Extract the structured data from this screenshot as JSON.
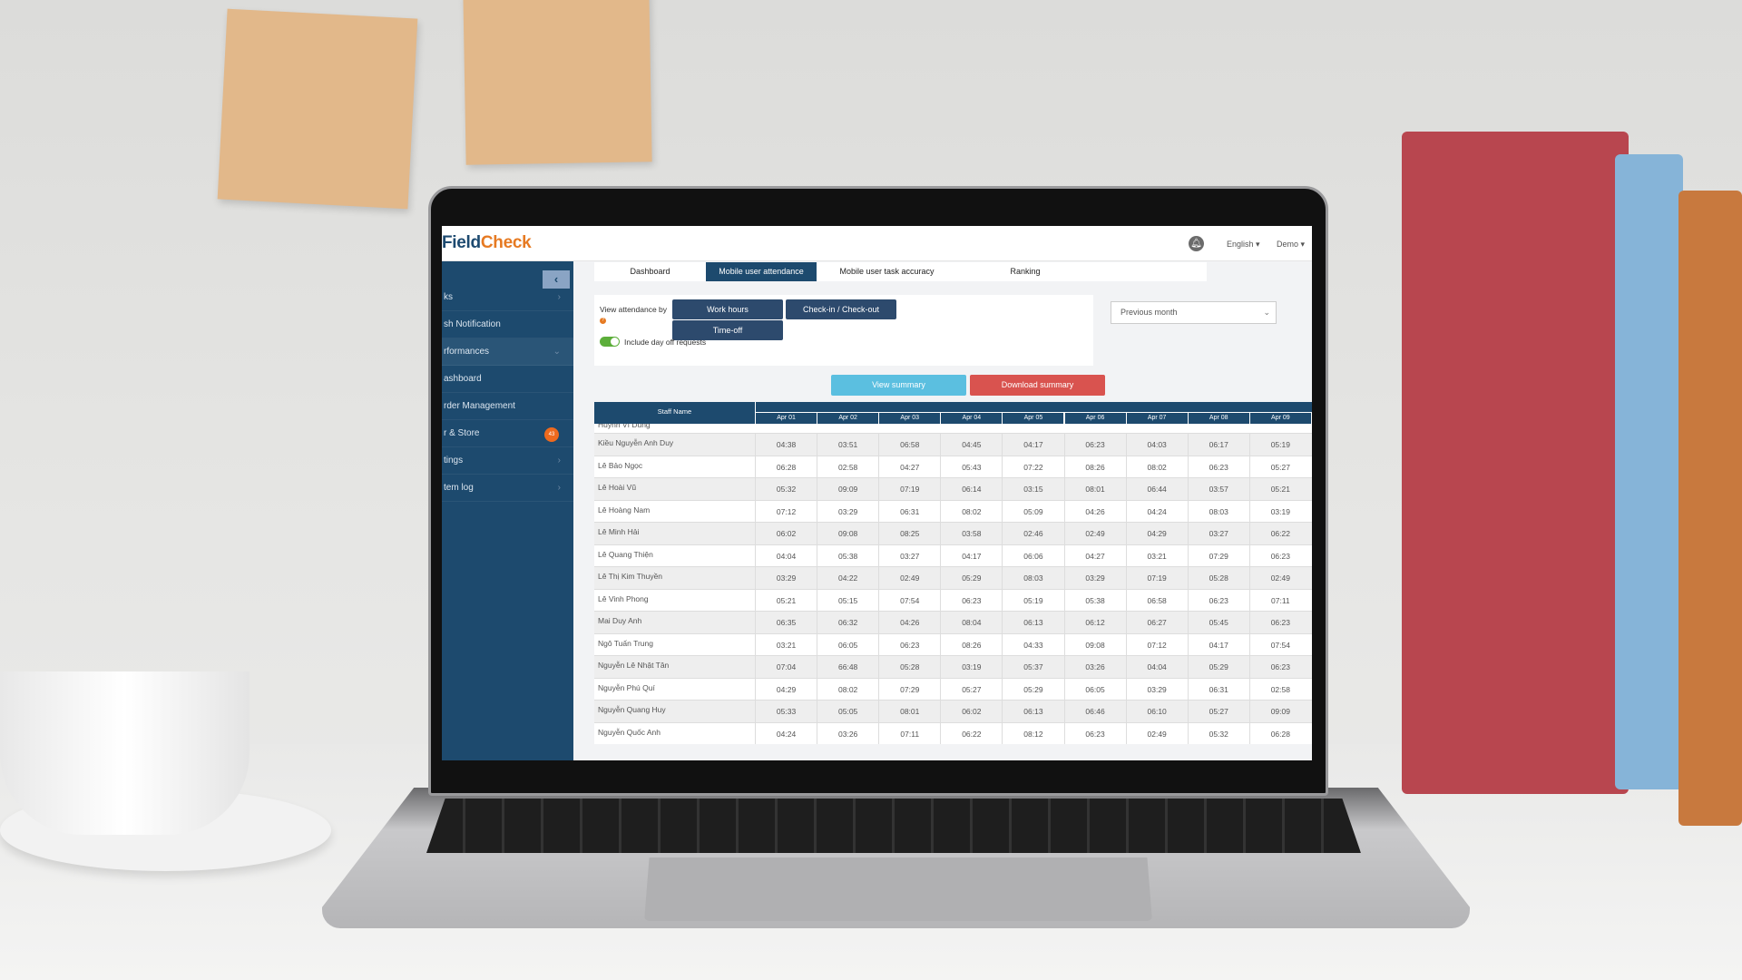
{
  "app": {
    "logo_a": "Field",
    "logo_b": "Check",
    "language": "English ▾",
    "user": "Demo ▾"
  },
  "sidebar": {
    "collapse_icon": "‹",
    "items": [
      {
        "label": "ks",
        "chevron": "›"
      },
      {
        "label": "sh Notification",
        "chevron": ""
      },
      {
        "label": "rformances",
        "chevron": "⌄"
      },
      {
        "label": "ashboard",
        "chevron": ""
      },
      {
        "label": "rder Management",
        "chevron": ""
      },
      {
        "label": "r & Store",
        "badge": "43"
      },
      {
        "label": "tings",
        "chevron": "›"
      },
      {
        "label": "tem log",
        "chevron": "›"
      }
    ]
  },
  "tabs": [
    {
      "label": "Dashboard"
    },
    {
      "label": "Mobile user attendance",
      "active": true
    },
    {
      "label": "Mobile user task accuracy"
    },
    {
      "label": "Ranking"
    }
  ],
  "filters": {
    "view_by_label": "View attendance by",
    "help_icon": "?",
    "work_hours": "Work hours",
    "check_in_out": "Check-in / Check-out",
    "time_off": "Time-off",
    "include_day_off": "Include day off requests",
    "include_day_off_on": true,
    "period": "Previous month"
  },
  "actions": {
    "view_summary": "View summary",
    "download_summary": "Download summary"
  },
  "colors": {
    "primary": "#1d4a6e",
    "accent": "#e67a22",
    "view": "#5bbfe0",
    "download": "#d9534f",
    "toggle": "#5cae3a"
  },
  "table": {
    "name_header": "Staff Name",
    "dates": [
      "Apr 01",
      "Apr 02",
      "Apr 03",
      "Apr 04",
      "Apr 05",
      "Apr 06",
      "Apr 07",
      "Apr 08",
      "Apr 09"
    ],
    "partial_row": "Huỳnh Vĩ Dũng",
    "rows": [
      {
        "name": "Kiều Nguyễn Anh Duy",
        "v": [
          "04:38",
          "03:51",
          "06:58",
          "04:45",
          "04:17",
          "06:23",
          "04:03",
          "06:17",
          "05:19"
        ]
      },
      {
        "name": "Lê Bảo Ngọc",
        "v": [
          "06:28",
          "02:58",
          "04:27",
          "05:43",
          "07:22",
          "08:26",
          "08:02",
          "06:23",
          "05:27"
        ]
      },
      {
        "name": "Lê Hoài Vũ",
        "v": [
          "05:32",
          "09:09",
          "07:19",
          "06:14",
          "03:15",
          "08:01",
          "06:44",
          "03:57",
          "05:21"
        ]
      },
      {
        "name": "Lê Hoàng Nam",
        "v": [
          "07:12",
          "03:29",
          "06:31",
          "08:02",
          "05:09",
          "04:26",
          "04:24",
          "08:03",
          "03:19"
        ]
      },
      {
        "name": "Lê Minh Hải",
        "v": [
          "06:02",
          "09:08",
          "08:25",
          "03:58",
          "02:46",
          "02:49",
          "04:29",
          "03:27",
          "06:22"
        ]
      },
      {
        "name": "Lê Quang Thiện",
        "v": [
          "04:04",
          "05:38",
          "03:27",
          "04:17",
          "06:06",
          "04:27",
          "03:21",
          "07:29",
          "06:23"
        ]
      },
      {
        "name": "Lê Thị Kim Thuyền",
        "v": [
          "03:29",
          "04:22",
          "02:49",
          "05:29",
          "08:03",
          "03:29",
          "07:19",
          "05:28",
          "02:49"
        ]
      },
      {
        "name": "Lê Vinh Phong",
        "v": [
          "05:21",
          "05:15",
          "07:54",
          "06:23",
          "05:19",
          "05:38",
          "06:58",
          "06:23",
          "07:11"
        ]
      },
      {
        "name": "Mai Duy Anh",
        "v": [
          "06:35",
          "06:32",
          "04:26",
          "08:04",
          "06:13",
          "06:12",
          "06:27",
          "05:45",
          "06:23"
        ]
      },
      {
        "name": "Ngô Tuấn Trung",
        "v": [
          "03:21",
          "06:05",
          "06:23",
          "08:26",
          "04:33",
          "09:08",
          "07:12",
          "04:17",
          "07:54"
        ]
      },
      {
        "name": "Nguyễn Lê Nhật Tân",
        "v": [
          "07:04",
          "66:48",
          "05:28",
          "03:19",
          "05:37",
          "03:26",
          "04:04",
          "05:29",
          "06:23"
        ]
      },
      {
        "name": "Nguyễn Phú Quí",
        "v": [
          "04:29",
          "08:02",
          "07:29",
          "05:27",
          "05:29",
          "06:05",
          "03:29",
          "06:31",
          "02:58"
        ]
      },
      {
        "name": "Nguyễn Quang Huy",
        "v": [
          "05:33",
          "05:05",
          "08:01",
          "06:02",
          "06:13",
          "06:46",
          "06:10",
          "05:27",
          "09:09"
        ]
      },
      {
        "name": "Nguyễn Quốc Anh",
        "v": [
          "04:24",
          "03:26",
          "07:11",
          "06:22",
          "08:12",
          "06:23",
          "02:49",
          "05:32",
          "06:28"
        ]
      }
    ]
  }
}
